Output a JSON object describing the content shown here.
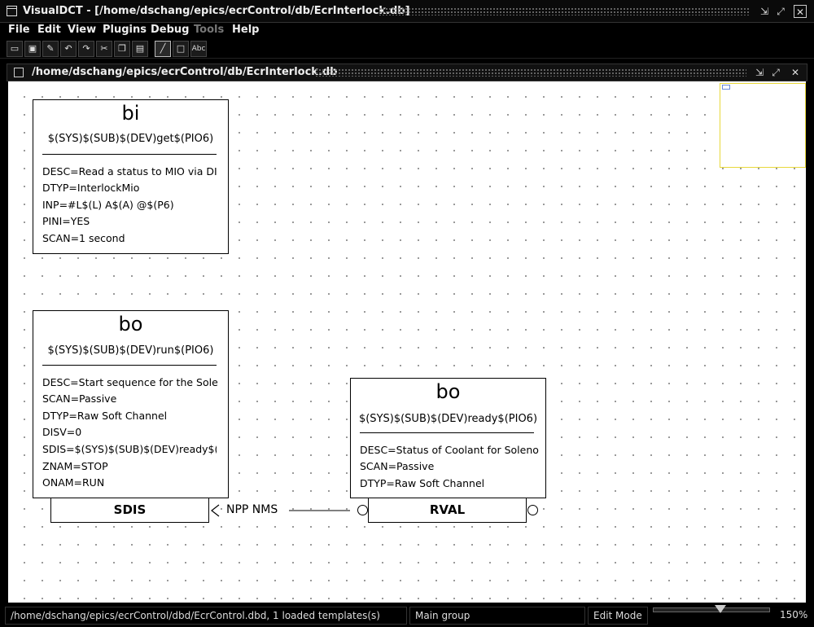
{
  "window": {
    "title": "VisualDCT  - [/home/dschang/epics/ecrControl/db/EcrInterlock.db]"
  },
  "menubar": [
    {
      "label": "File",
      "enabled": true
    },
    {
      "label": "Edit",
      "enabled": true
    },
    {
      "label": "View",
      "enabled": true
    },
    {
      "label": "Plugins",
      "enabled": true
    },
    {
      "label": "Debug",
      "enabled": true
    },
    {
      "label": "Tools",
      "enabled": false
    },
    {
      "label": "Help",
      "enabled": true
    }
  ],
  "toolbar": {
    "icons": [
      "open-icon",
      "save-icon",
      "pen-icon",
      "undo-icon",
      "redo-icon",
      "cut-icon",
      "copy-icon",
      "paste-icon",
      "line-icon",
      "box-icon",
      "text-icon"
    ],
    "text_tool_label": "Abc"
  },
  "document": {
    "title": "/home/dschang/epics/ecrControl/db/EcrInterlock.db"
  },
  "records": [
    {
      "type": "bi",
      "name": "$(SYS)$(SUB)$(DEV)get$(PIO6)",
      "fields": [
        "DESC=Read a status to MIO via DI",
        "DTYP=InterlockMio",
        "INP=#L$(L) A$(A) @$(P6)",
        "PINI=YES",
        "SCAN=1 second"
      ]
    },
    {
      "type": "bo",
      "name": "$(SYS)$(SUB)$(DEV)run$(PIO6)",
      "fields": [
        "DESC=Start sequence for the Sole",
        "SCAN=Passive",
        "DTYP=Raw Soft Channel",
        "DISV=0",
        "SDIS=$(SYS)$(SUB)$(DEV)ready$(PI",
        "ZNAM=STOP",
        "ONAM=RUN"
      ],
      "port": "SDIS"
    },
    {
      "type": "bo",
      "name": "$(SYS)$(SUB)$(DEV)ready$(PIO6)",
      "fields": [
        "DESC=Status of Coolant for Soleno",
        "SCAN=Passive",
        "DTYP=Raw Soft Channel"
      ],
      "port": "RVAL"
    }
  ],
  "link": {
    "label": "NPP NMS"
  },
  "statusbar": {
    "dbd": "/home/dschang/epics/ecrControl/dbd/EcrControl.dbd, 1 loaded templates(s)",
    "group": "Main group",
    "mode": "Edit Mode",
    "zoom": "150%",
    "zoom_level": 150
  },
  "colors": {
    "navigator_border": "#e8d83a",
    "canvas": "#ffffff",
    "chrome": "#000000"
  }
}
